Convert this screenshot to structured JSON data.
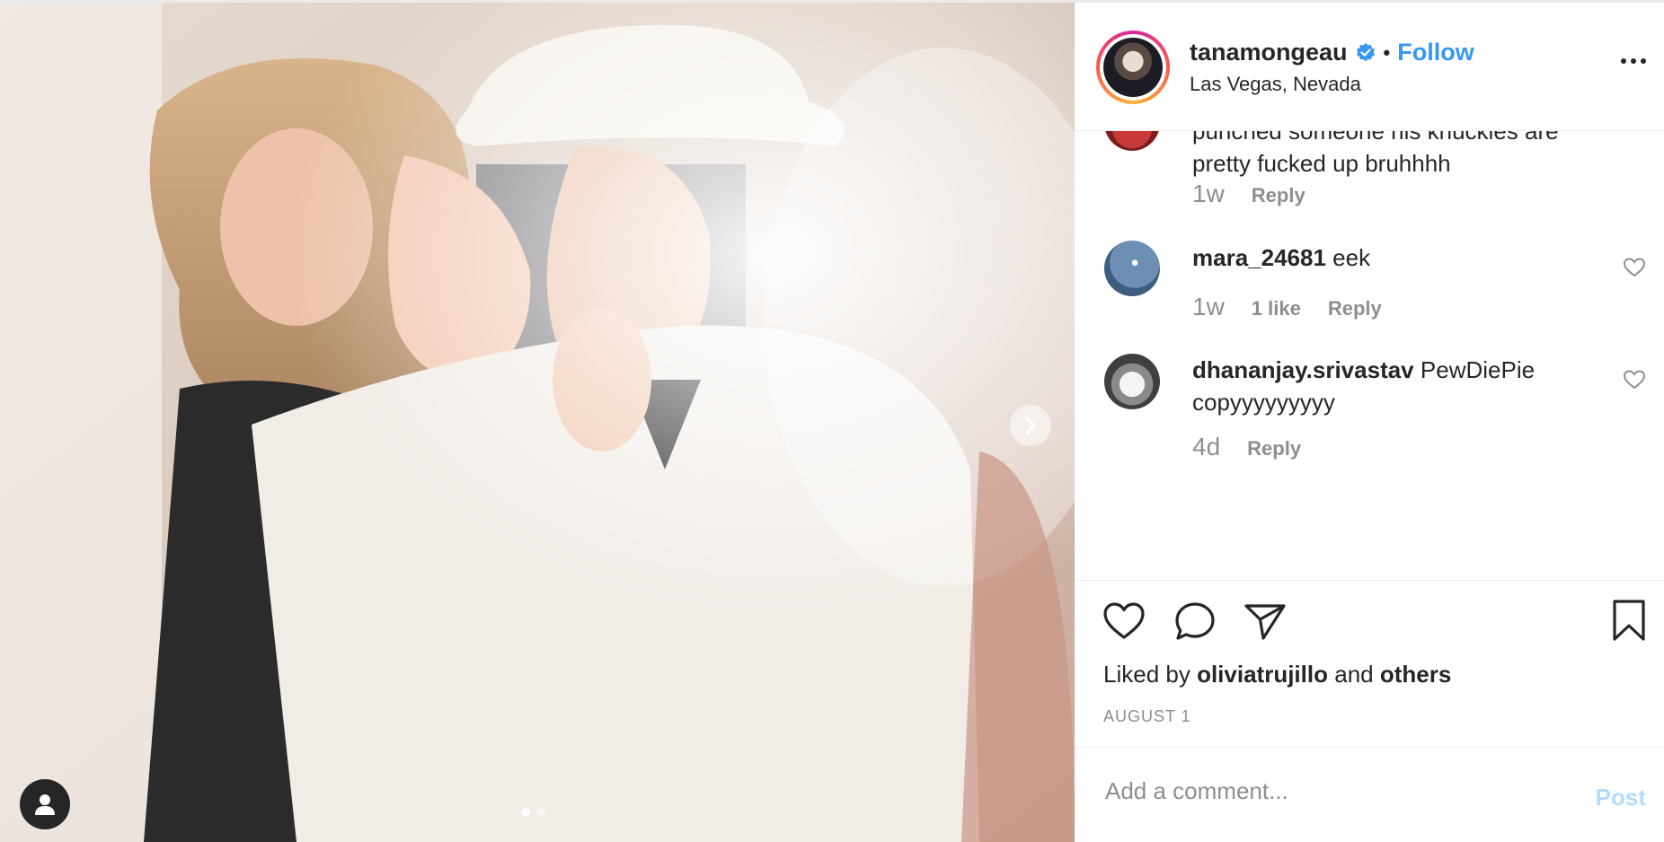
{
  "post": {
    "username": "tanamongeau",
    "follow_label": "Follow",
    "separator": "•",
    "location": "Las Vegas, Nevada",
    "carousel": {
      "slide_count": 2,
      "active_index": 0
    }
  },
  "comments": [
    {
      "text": "punched someone his knuckles are pretty fucked up bruhhhh",
      "time": "1w",
      "reply_label": "Reply"
    },
    {
      "user": "mara_24681",
      "text": "eek",
      "time": "1w",
      "likes_label": "1 like",
      "reply_label": "Reply"
    },
    {
      "user": "dhananjay.srivastav",
      "text": "PewDiePie copyyyyyyyyy",
      "time": "4d",
      "reply_label": "Reply"
    }
  ],
  "footer": {
    "liked_prefix": "Liked by",
    "liked_user": "oliviatrujillo",
    "liked_and": "and",
    "liked_others": "others",
    "date": "AUGUST 1",
    "comment_placeholder": "Add a comment...",
    "post_label": "Post"
  },
  "colors": {
    "link_blue": "#3897f0",
    "muted_gray": "#8e8e8e",
    "post_disabled": "#b3dbff",
    "verified_blue": "#3897f0"
  },
  "icons": {
    "verified": "verified-badge-icon",
    "more": "more-options-icon",
    "next": "chevron-right-icon",
    "user_tag": "user-tag-icon",
    "like": "heart-icon",
    "comment": "comment-icon",
    "share": "paper-plane-icon",
    "save": "bookmark-icon"
  }
}
